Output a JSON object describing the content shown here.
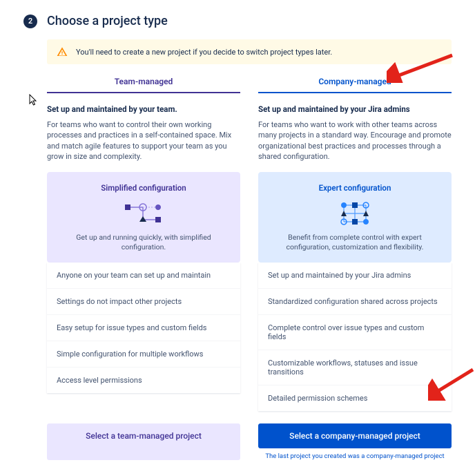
{
  "step_number": "2",
  "step_title": "Choose a project type",
  "banner_text": "You'll need to create a new project if you decide to switch project types later.",
  "tabs": {
    "team": "Team-managed",
    "company": "Company-managed"
  },
  "team": {
    "heading": "Set up and maintained by your team.",
    "desc": "For teams who want to control their own working processes and practices in a self-contained space. Mix and match agile features to support your team as you grow in size and complexity.",
    "config_title": "Simplified configuration",
    "config_sub": "Get up and running quickly, with simplified configuration.",
    "features": [
      "Anyone on your team can set up and maintain",
      "Settings do not impact other projects",
      "Easy setup for issue types and custom fields",
      "Simple configuration for multiple workflows",
      "Access level permissions"
    ],
    "button": "Select a team-managed project"
  },
  "company": {
    "heading": "Set up and maintained by your Jira admins",
    "desc": "For teams who want to work with other teams across many projects in a standard way. Encourage and promote organizational best practices and processes through a shared configuration.",
    "config_title": "Expert configuration",
    "config_sub": "Benefit from complete control with expert configuration, customization and flexibility.",
    "features": [
      "Set up and maintained by your Jira admins",
      "Standardized configuration shared across projects",
      "Complete control over issue types and custom fields",
      "Customizable workflows, statuses and issue transitions",
      "Detailed permission schemes"
    ],
    "button": "Select a company-managed project"
  },
  "last_note": "The last project you created was a company-managed project"
}
